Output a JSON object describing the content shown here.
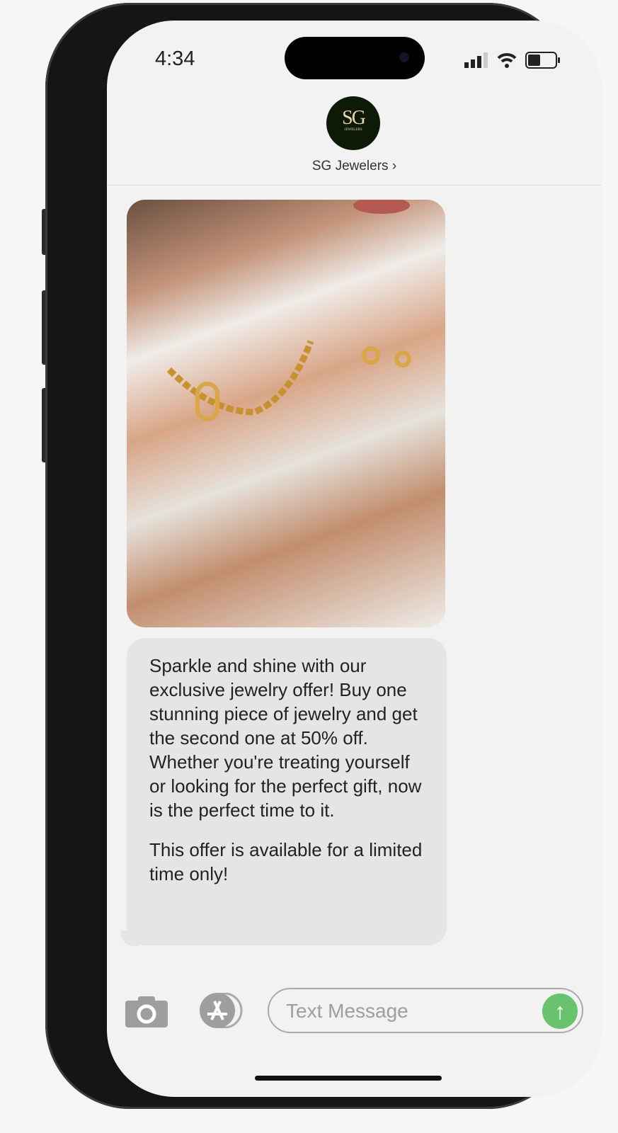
{
  "status_bar": {
    "time": "4:34"
  },
  "contact": {
    "avatar_text": "SG",
    "avatar_subtext": "JEWELERS",
    "name": "SG Jewelers",
    "chevron": "›"
  },
  "messages": [
    {
      "type": "image",
      "description_icon": "jewelry-photo"
    },
    {
      "type": "text",
      "paragraphs": [
        "Sparkle and shine with our exclusive jewelry offer! Buy one stunning piece of jewelry and get the second one at 50% off. Whether you're treating yourself or looking for the perfect gift, now is the perfect time to it.",
        "This offer is available for a limited time only!"
      ]
    }
  ],
  "composer": {
    "placeholder": "Text Message",
    "send_icon": "↑"
  },
  "colors": {
    "send": "#68c26e",
    "bubble": "#e5e5e5",
    "avatar": "#0d1a05"
  }
}
